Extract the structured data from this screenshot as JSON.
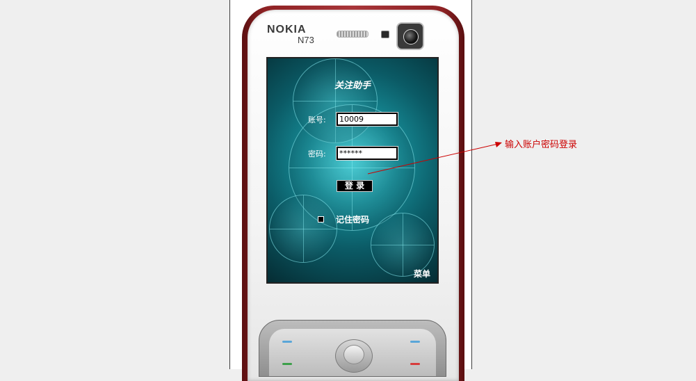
{
  "phone": {
    "brand": "NOKIA",
    "model": "N73"
  },
  "screen": {
    "app_title": "关注助手",
    "account_label": "账号:",
    "account_value": "10009",
    "password_label": "密码:",
    "password_value": "******",
    "login_button": "登 录",
    "remember_label": "记住密码",
    "menu_softkey": "菜单"
  },
  "annotation": {
    "text": "输入账户密码登录",
    "color": "#cc0000"
  },
  "colors": {
    "page_background": "#efefef",
    "screen_teal": "#168b96",
    "phone_red": "#8e2224"
  }
}
